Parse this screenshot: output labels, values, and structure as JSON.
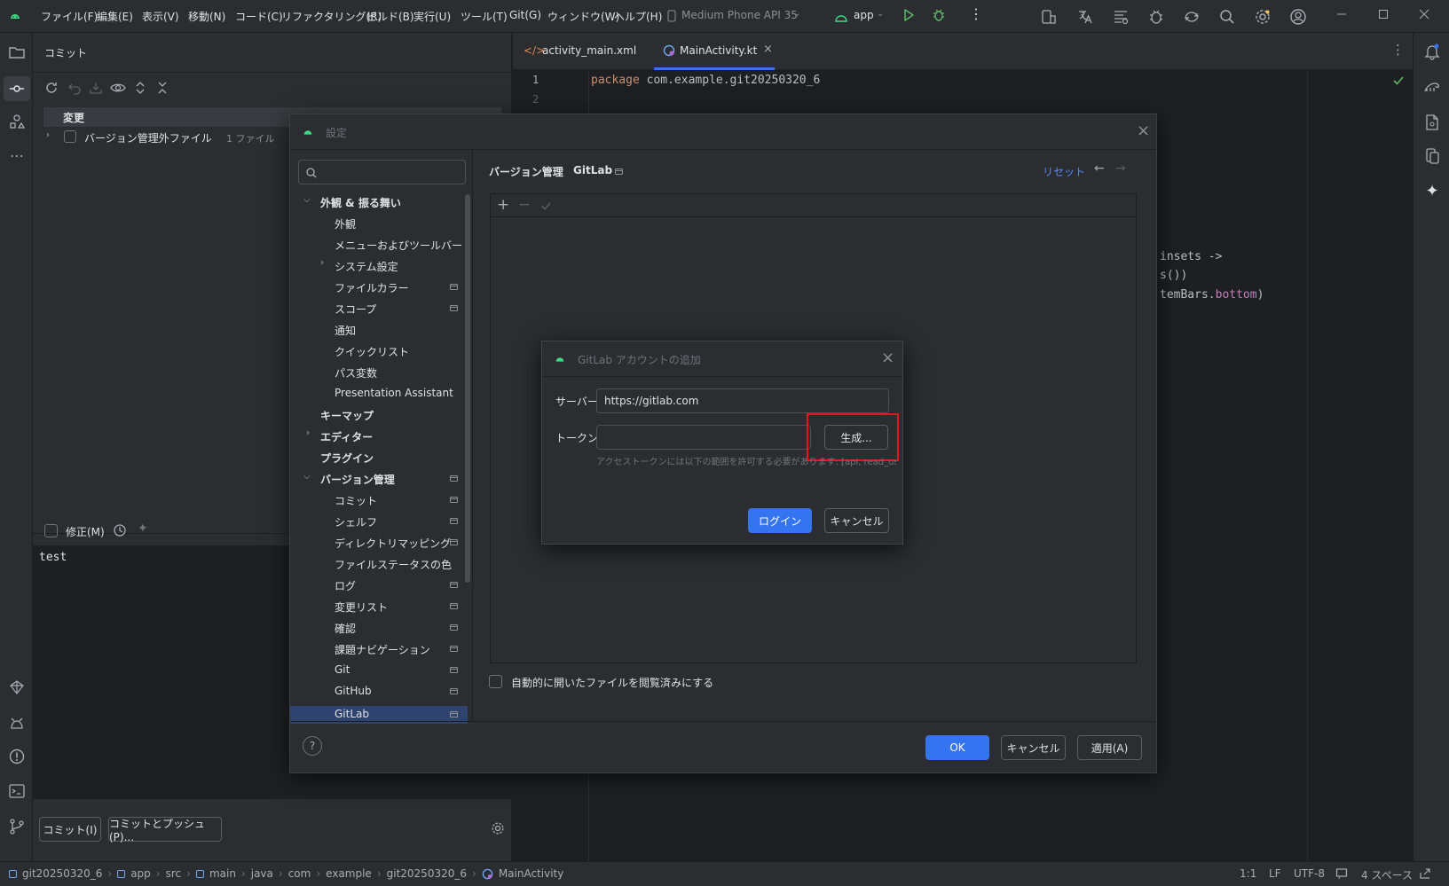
{
  "titlebar": {
    "menus": [
      "ファイル(F)",
      "編集(E)",
      "表示(V)",
      "移動(N)",
      "コード(C)",
      "リファクタリング(R)",
      "ビルド(B)",
      "実行(U)",
      "ツール(T)",
      "Git(G)",
      "ウィンドウ(W)",
      "ヘルプ(H)"
    ],
    "device": "Medium Phone API 35",
    "run_config": "app"
  },
  "commit_panel": {
    "title": "コミット",
    "changes_label": "変更",
    "unversioned_label": "バージョン管理外ファイル",
    "unversioned_count": "1 ファイル",
    "amend_label": "修正(M)",
    "message": "test",
    "commit_button": "コミット(I)",
    "commit_push_button": "コミットとプッシュ(P)..."
  },
  "editor": {
    "tabs": [
      {
        "label": "activity_main.xml",
        "active": false
      },
      {
        "label": "MainActivity.kt",
        "active": true
      }
    ],
    "line_numbers": [
      "1",
      "2"
    ],
    "line1_keyword": "package",
    "line1_rest": " com.example.git20250320_6",
    "frag1": "insets ->",
    "frag2": "s())",
    "frag3_a": "temBars.",
    "frag3_b": "bottom",
    "frag3_c": ")"
  },
  "settings": {
    "title": "設定",
    "search_placeholder": "",
    "breadcrumb_parent": "バージョン管理",
    "breadcrumb_current": "GitLab",
    "reset_label": "リセット",
    "tree": {
      "appearance_group": "外観 & 振る舞い",
      "appearance": "外観",
      "menus_toolbars": "メニューおよびツールバー",
      "system_settings": "システム設定",
      "file_colors": "ファイルカラー",
      "scopes": "スコープ",
      "notifications": "通知",
      "quick_lists": "クイックリスト",
      "path_variables": "パス変数",
      "presentation_assistant": "Presentation Assistant",
      "keymap": "キーマップ",
      "editor": "エディター",
      "plugins": "プラグイン",
      "vcs_group": "バージョン管理",
      "vcs_commit": "コミット",
      "vcs_shelf": "シェルフ",
      "vcs_dir_mapping": "ディレクトリマッピング",
      "vcs_file_status_colors": "ファイルステータスの色",
      "vcs_log": "ログ",
      "vcs_changelists": "変更リスト",
      "vcs_confirmation": "確認",
      "vcs_issue_navigation": "課題ナビゲーション",
      "vcs_git": "Git",
      "vcs_github": "GitHub",
      "vcs_gitlab": "GitLab"
    },
    "auto_mark_label": "自動的に開いたファイルを閲覧済みにする",
    "ok_button": "OK",
    "cancel_button": "キャンセル",
    "apply_button": "適用(A)"
  },
  "gitlab_dialog": {
    "title": "GitLab アカウントの追加",
    "server_label": "サーバー:",
    "server_value": "https://gitlab.com",
    "token_label": "トークン:",
    "token_value": "",
    "generate_button": "生成...",
    "hint": "アクセストークンには以下の範囲を許可する必要があります: [api, read_user]",
    "login_button": "ログイン",
    "cancel_button": "キャンセル"
  },
  "statusbar": {
    "breadcrumbs": [
      "git20250320_6",
      "app",
      "src",
      "main",
      "java",
      "com",
      "example",
      "git20250320_6",
      "MainActivity"
    ],
    "position": "1:1",
    "line_sep": "LF",
    "encoding": "UTF-8",
    "indent": "4 スペース"
  },
  "colors": {
    "accent": "#3574f0",
    "highlight_box": "#e0191f",
    "keyword": "#cf8e6d",
    "field_purple": "#c77dbb",
    "android_green": "#3ddc84"
  }
}
